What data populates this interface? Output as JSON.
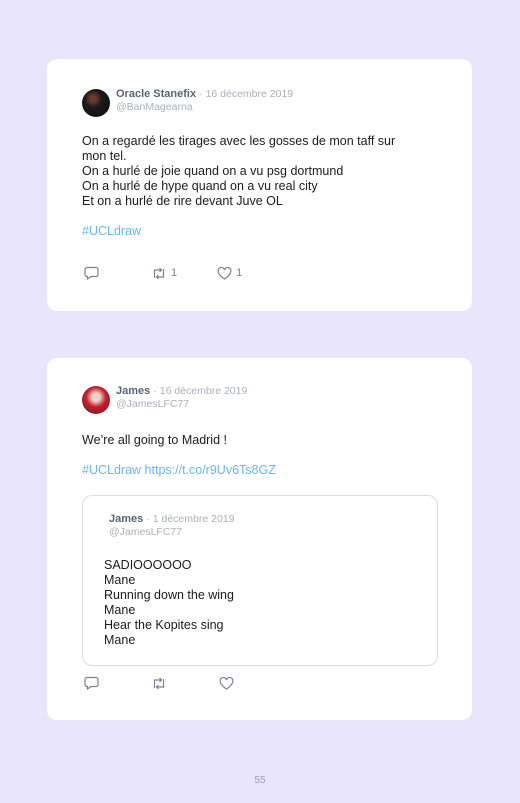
{
  "tweets": [
    {
      "author": "Oracle Stanefix",
      "date": "· 16 décembre 2019",
      "handle": "@BanMagearna",
      "lines": [
        "On a regardé les tirages avec les gosses de mon taff sur",
        "mon tel.",
        "On a hurlé de joie quand on a vu psg dortmund",
        "On a hurlé de hype quand on a vu real city",
        "Et on a hurlé de rire devant Juve OL"
      ],
      "hashtag": "#UCLdraw",
      "retweets": "1",
      "likes": "1"
    },
    {
      "author": "James",
      "date": "· 16 décembre 2019",
      "handle": "@JamesLFC77",
      "text": "We’re all going to Madrid !",
      "hashtag": "#UCLdraw",
      "link": "https://t.co/r9Uv6Ts8GZ",
      "quoted": {
        "author": "James",
        "date": "· 1 décembre 2019",
        "handle": "@JamesLFC77",
        "lines": [
          "SADIOOOOOO",
          "Mane",
          "Running down the wing",
          "Mane",
          "Hear the Kopites sing",
          "Mane"
        ]
      }
    }
  ],
  "icons": [
    "reply-icon",
    "retweet-icon",
    "like-icon"
  ],
  "page_number": "55"
}
